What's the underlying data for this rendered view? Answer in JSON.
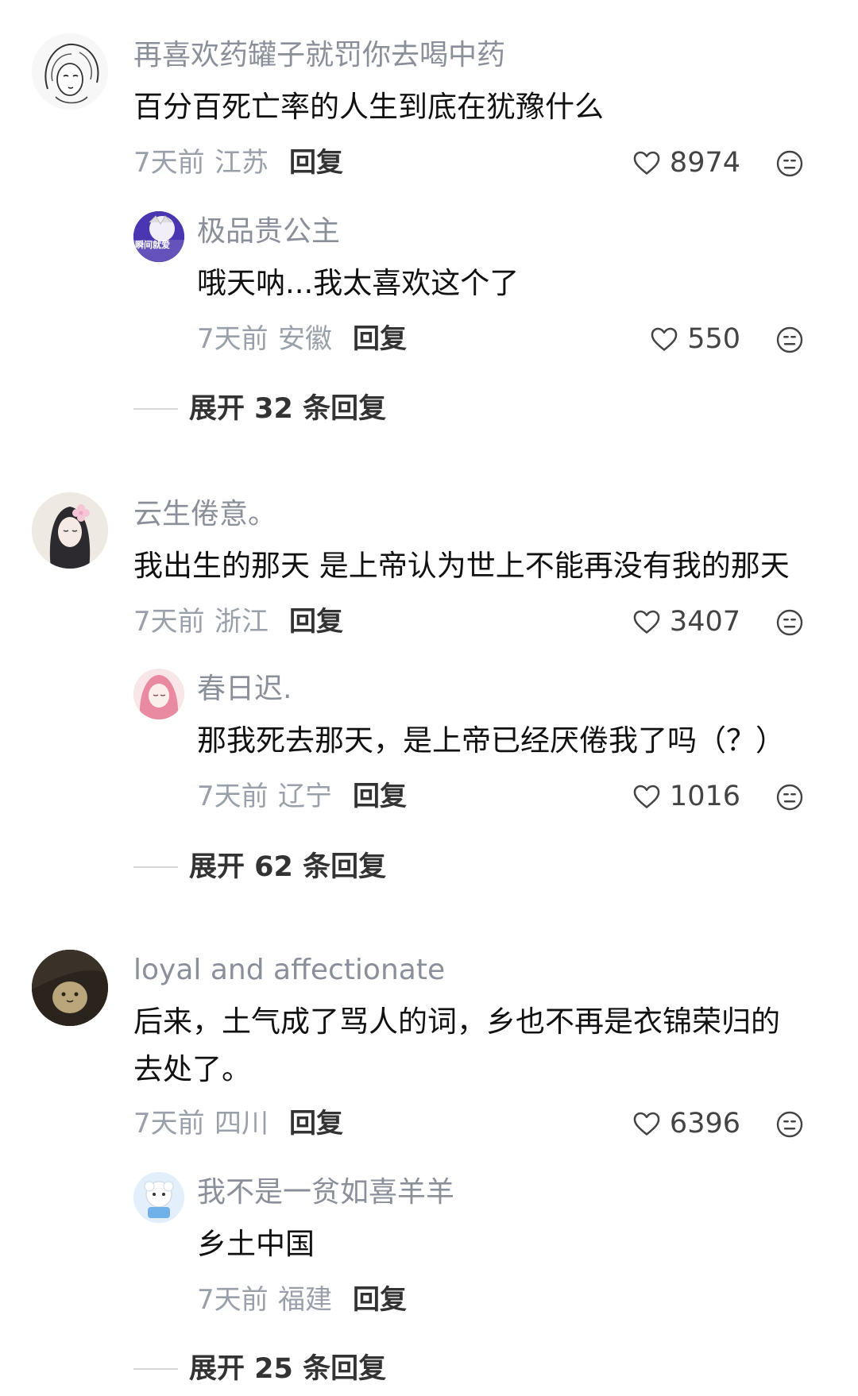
{
  "comments": [
    {
      "user": "再喜欢药罐子就罚你去喝中药",
      "lines": [
        "百分百死亡率的人生到底在犹豫什么"
      ],
      "time": "7天前",
      "location": "江苏",
      "reply_label": "回复",
      "likes": "8974",
      "avatar_icon": "sketch-girl-icon",
      "reply": {
        "user": "极品贵公主",
        "lines": [
          "哦天呐...我太喜欢这个了"
        ],
        "time": "7天前",
        "location": "安徽",
        "reply_label": "回复",
        "likes": "550",
        "avatar_text": "瞬间就爱"
      },
      "expand": "展开 32 条回复"
    },
    {
      "user": "云生倦意。",
      "lines": [
        "我出生的那天 是上帝认为世上不能再没有我的那天"
      ],
      "time": "7天前",
      "location": "浙江",
      "reply_label": "回复",
      "likes": "3407",
      "avatar_icon": "flower-girl-icon",
      "reply": {
        "user": "春日迟.",
        "lines": [
          "那我死去那天，是上帝已经厌倦我了吗（？）"
        ],
        "time": "7天前",
        "location": "辽宁",
        "reply_label": "回复",
        "likes": "1016"
      },
      "expand": "展开 62 条回复"
    },
    {
      "user": "loyal and affectionate",
      "lines": [
        "后来，土气成了骂人的词，乡也不再是衣锦荣归的",
        "去处了。"
      ],
      "time": "7天前",
      "location": "四川",
      "reply_label": "回复",
      "likes": "6396",
      "avatar_icon": "plush-toy-icon",
      "reply": {
        "user": "我不是一贫如喜羊羊",
        "lines": [
          "乡土中国"
        ],
        "time": "7天前",
        "location": "福建",
        "reply_label": "回复"
      },
      "expand": "展开 25 条回复"
    }
  ],
  "colors": {
    "name": "#8a8f99",
    "meta": "#9aa0aa",
    "content": "#111111",
    "divider": "#d8d8d8"
  }
}
